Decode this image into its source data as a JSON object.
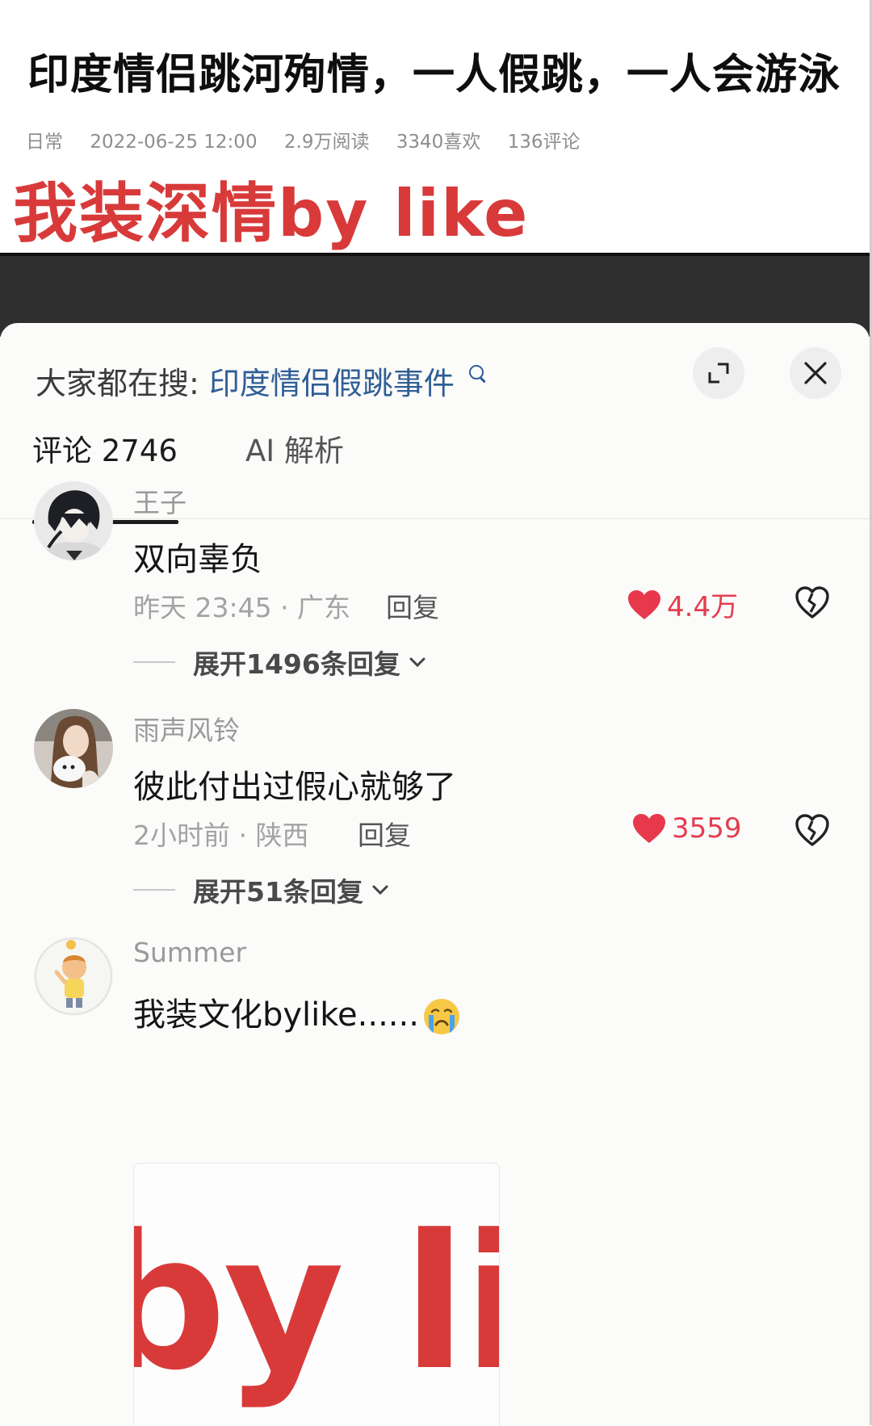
{
  "article": {
    "title": "印度情侣跳河殉情，一人假跳，一人会游泳",
    "meta": {
      "category": "日常",
      "datetime": "2022-06-25 12:00",
      "reads": "2.9万阅读",
      "likes": "3340喜欢",
      "comments": "136评论"
    },
    "overlay_text": "我装深情by like"
  },
  "sheet": {
    "search_label": "大家都在搜:",
    "search_term": "印度情侣假跳事件",
    "tabs": [
      {
        "label": "评论 2746",
        "active": true
      },
      {
        "label": "AI 解析",
        "active": false
      }
    ]
  },
  "comments": [
    {
      "username": "王子",
      "text": "双向辜负",
      "time_location": "昨天 23:45 · 广东",
      "reply_label": "回复",
      "likes": "4.4万",
      "expand_replies": "展开1496条回复"
    },
    {
      "username": "雨声风铃",
      "text": "彼此付出过假心就够了",
      "time_location": "2小时前 · 陕西",
      "reply_label": "回复",
      "likes": "3559",
      "expand_replies": "展开51条回复"
    },
    {
      "username": "Summer",
      "text": "我装文化bylike......",
      "emoji": "crying-face-icon",
      "image_text": "by lik"
    }
  ],
  "colors": {
    "accent_red": "#d83a3a",
    "like_red": "#e43d4f",
    "link_blue": "#2f5e95"
  }
}
